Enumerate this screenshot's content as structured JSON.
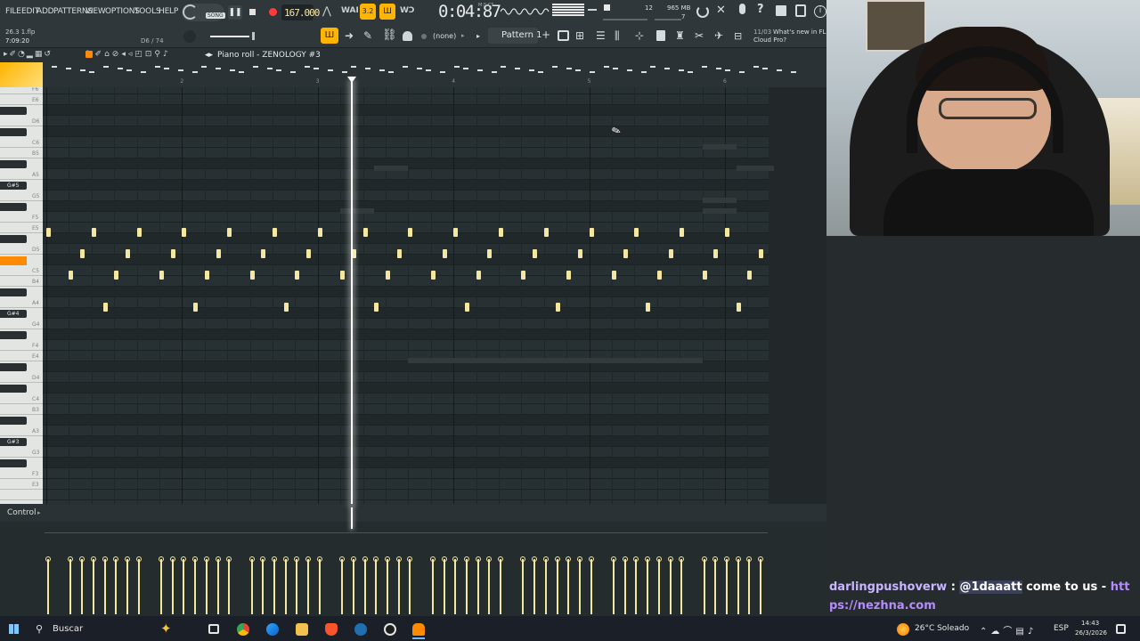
{
  "menu": [
    "FILE",
    "EDIT",
    "ADD",
    "PATTERNS",
    "VIEW",
    "OPTIONS",
    "TOOLS",
    "HELP"
  ],
  "song_label": "SONG",
  "tempo": "167.000",
  "time_display": "0:04:87",
  "time_caption": "M:S:CS",
  "cpu_value": "12",
  "memory_value": "965 MB",
  "poly_value": "7",
  "news": {
    "date": "11/03",
    "line1": "What's new in FL",
    "line2": "Cloud Pro?"
  },
  "file_info": {
    "name": "26.3 1.flp",
    "time": "7:09:20",
    "note_hint": "D6 / 74"
  },
  "snap_label": "(none)",
  "pattern_label": "Pattern 1",
  "pianoroll_title": "Piano roll - ZENOLOGY #3",
  "control_label": "Control",
  "bar_numbers": [
    "2",
    "3",
    "4",
    "5",
    "6",
    "7",
    "8",
    "9"
  ],
  "key_labels": [
    {
      "label": "F6",
      "row": 0
    },
    {
      "label": "E6",
      "row": 1
    },
    {
      "label": "D6",
      "row": 3
    },
    {
      "label": "C6",
      "row": 5
    },
    {
      "label": "B5",
      "row": 6
    },
    {
      "label": "A5",
      "row": 8
    },
    {
      "label": "G#5",
      "row": 9
    },
    {
      "label": "G5",
      "row": 10
    },
    {
      "label": "F5",
      "row": 12
    },
    {
      "label": "E5",
      "row": 13
    },
    {
      "label": "D5",
      "row": 15
    },
    {
      "label": "C5",
      "row": 17
    },
    {
      "label": "B4",
      "row": 18
    },
    {
      "label": "A4",
      "row": 20
    },
    {
      "label": "G#4",
      "row": 21
    },
    {
      "label": "G4",
      "row": 22
    },
    {
      "label": "F4",
      "row": 24
    },
    {
      "label": "E4",
      "row": 25
    },
    {
      "label": "D4",
      "row": 27
    },
    {
      "label": "C4",
      "row": 29
    },
    {
      "label": "B3",
      "row": 30
    },
    {
      "label": "A3",
      "row": 32
    },
    {
      "label": "G#3",
      "row": 33
    },
    {
      "label": "G3",
      "row": 34
    },
    {
      "label": "F3",
      "row": 36
    },
    {
      "label": "E3",
      "row": 37
    }
  ],
  "highlighted_key_row": 16,
  "notes": {
    "row13": [
      0,
      3,
      6,
      9,
      12,
      15,
      18,
      21,
      24,
      27,
      30,
      33,
      36,
      39,
      42,
      45
    ],
    "row15": [
      2.25,
      5.25,
      8.25,
      11.25,
      14.25,
      17.25,
      20.25,
      23.25,
      26.25,
      29.25,
      32.25,
      35.25,
      38.25,
      41.25,
      44.25,
      47.25
    ],
    "row17": [
      1.5,
      4.5,
      7.5,
      10.5,
      13.5,
      16.5,
      19.5,
      22.5,
      25.5,
      28.5,
      31.5,
      34.5,
      37.5,
      40.5,
      43.5,
      46.5
    ],
    "row20": [
      3.75,
      9.75,
      15.75,
      21.75,
      27.75,
      33.75,
      39.75,
      45.75
    ]
  },
  "ghost_notes": [
    {
      "row": 5,
      "start": 43.5,
      "len": 2.25
    },
    {
      "row": 7,
      "start": 21.75,
      "len": 2.25
    },
    {
      "row": 7,
      "start": 45.75,
      "len": 2.5
    },
    {
      "row": 10,
      "start": 43.5,
      "len": 2.25
    },
    {
      "row": 11,
      "start": 19.5,
      "len": 2.25
    },
    {
      "row": 11,
      "start": 43.5,
      "len": 2.25
    },
    {
      "row": 25,
      "start": 24,
      "len": 19.5
    }
  ],
  "playhead_beat": 20.25,
  "chat": {
    "user": "darlingpushoverw",
    "mention": "@1daaatt",
    "text": "come to us -",
    "link": "https://nezhna.com"
  },
  "taskbar": {
    "search_placeholder": "Buscar",
    "weather": "26°C Soleado",
    "lang": "ESP",
    "time": "14:43",
    "date": "26/3/2026"
  },
  "colors": {
    "note": "#f5e7a0",
    "accent": "#ff8a00",
    "chat_user": "#c9b6ff",
    "link": "#b58cff"
  }
}
